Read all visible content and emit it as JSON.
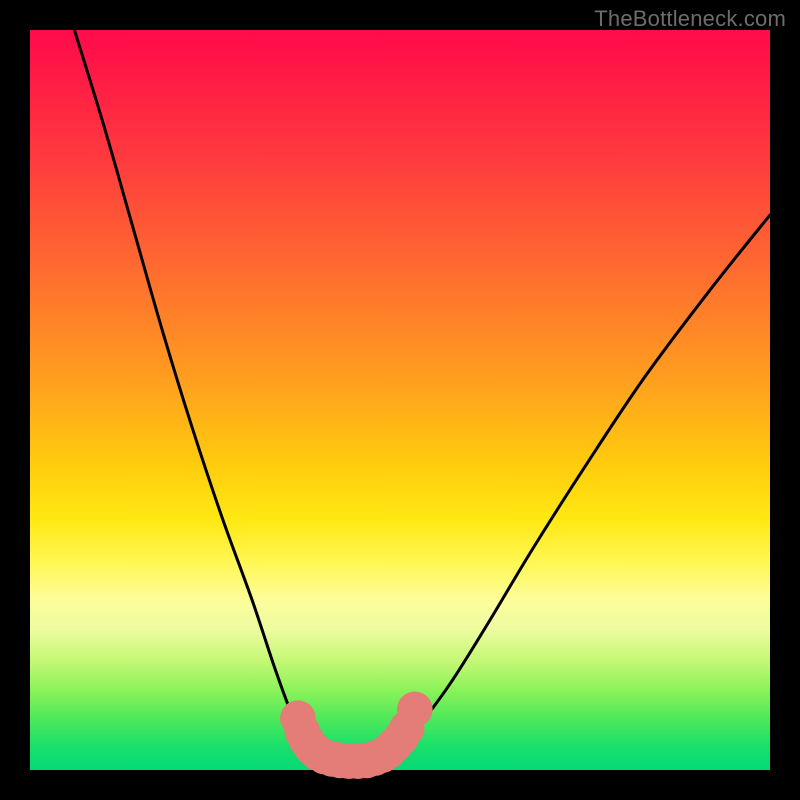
{
  "attribution": "TheBottleneck.com",
  "colors": {
    "frame": "#000000",
    "curve": "#000000",
    "markers": "#e47c78",
    "gradient_stops": [
      "#ff0b4a",
      "#ff1a46",
      "#ff3c3e",
      "#ff6a30",
      "#ff9a20",
      "#ffc90e",
      "#ffe812",
      "#fff754",
      "#fdfd9a",
      "#ecfca0",
      "#c7f877",
      "#8ef35a",
      "#4fe95a",
      "#17df6a",
      "#04da77"
    ]
  },
  "chart_data": {
    "type": "line",
    "title": "",
    "xlabel": "",
    "ylabel": "",
    "xlim": [
      0,
      100
    ],
    "ylim": [
      0,
      100
    ],
    "grid": false,
    "series": [
      {
        "name": "left-branch",
        "x": [
          6,
          10,
          14,
          18,
          22,
          26,
          30,
          33,
          35,
          36.5,
          37.5,
          38.5,
          39.5
        ],
        "y": [
          100,
          87,
          73,
          59,
          46,
          34,
          23,
          14,
          8.5,
          5.5,
          3.8,
          2.6,
          1.8
        ]
      },
      {
        "name": "valley-floor",
        "x": [
          39.5,
          41,
          43,
          45,
          47,
          48.5
        ],
        "y": [
          1.8,
          1.3,
          1.0,
          1.0,
          1.3,
          1.8
        ]
      },
      {
        "name": "right-branch",
        "x": [
          48.5,
          50,
          53,
          57,
          62,
          68,
          75,
          83,
          92,
          100
        ],
        "y": [
          1.8,
          3.0,
          6.5,
          12,
          20,
          30,
          41,
          53,
          65,
          75
        ]
      }
    ],
    "markers": [
      {
        "x": 36.2,
        "y": 7.0,
        "r": 1.6
      },
      {
        "x": 36.8,
        "y": 5.2,
        "r": 1.6
      },
      {
        "x": 37.4,
        "y": 4.0,
        "r": 1.6
      },
      {
        "x": 38.1,
        "y": 3.0,
        "r": 1.6
      },
      {
        "x": 38.9,
        "y": 2.3,
        "r": 1.6
      },
      {
        "x": 39.8,
        "y": 1.8,
        "r": 1.6
      },
      {
        "x": 40.8,
        "y": 1.5,
        "r": 1.6
      },
      {
        "x": 41.9,
        "y": 1.3,
        "r": 1.6
      },
      {
        "x": 43.1,
        "y": 1.2,
        "r": 1.6
      },
      {
        "x": 44.3,
        "y": 1.2,
        "r": 1.6
      },
      {
        "x": 45.5,
        "y": 1.3,
        "r": 1.6
      },
      {
        "x": 46.6,
        "y": 1.6,
        "r": 1.6
      },
      {
        "x": 47.6,
        "y": 2.0,
        "r": 1.6
      },
      {
        "x": 48.5,
        "y": 2.6,
        "r": 1.6
      },
      {
        "x": 49.3,
        "y": 3.4,
        "r": 1.6
      },
      {
        "x": 50.1,
        "y": 4.3,
        "r": 1.6
      },
      {
        "x": 50.9,
        "y": 5.6,
        "r": 1.6
      },
      {
        "x": 52.0,
        "y": 8.2,
        "r": 1.6
      }
    ]
  }
}
